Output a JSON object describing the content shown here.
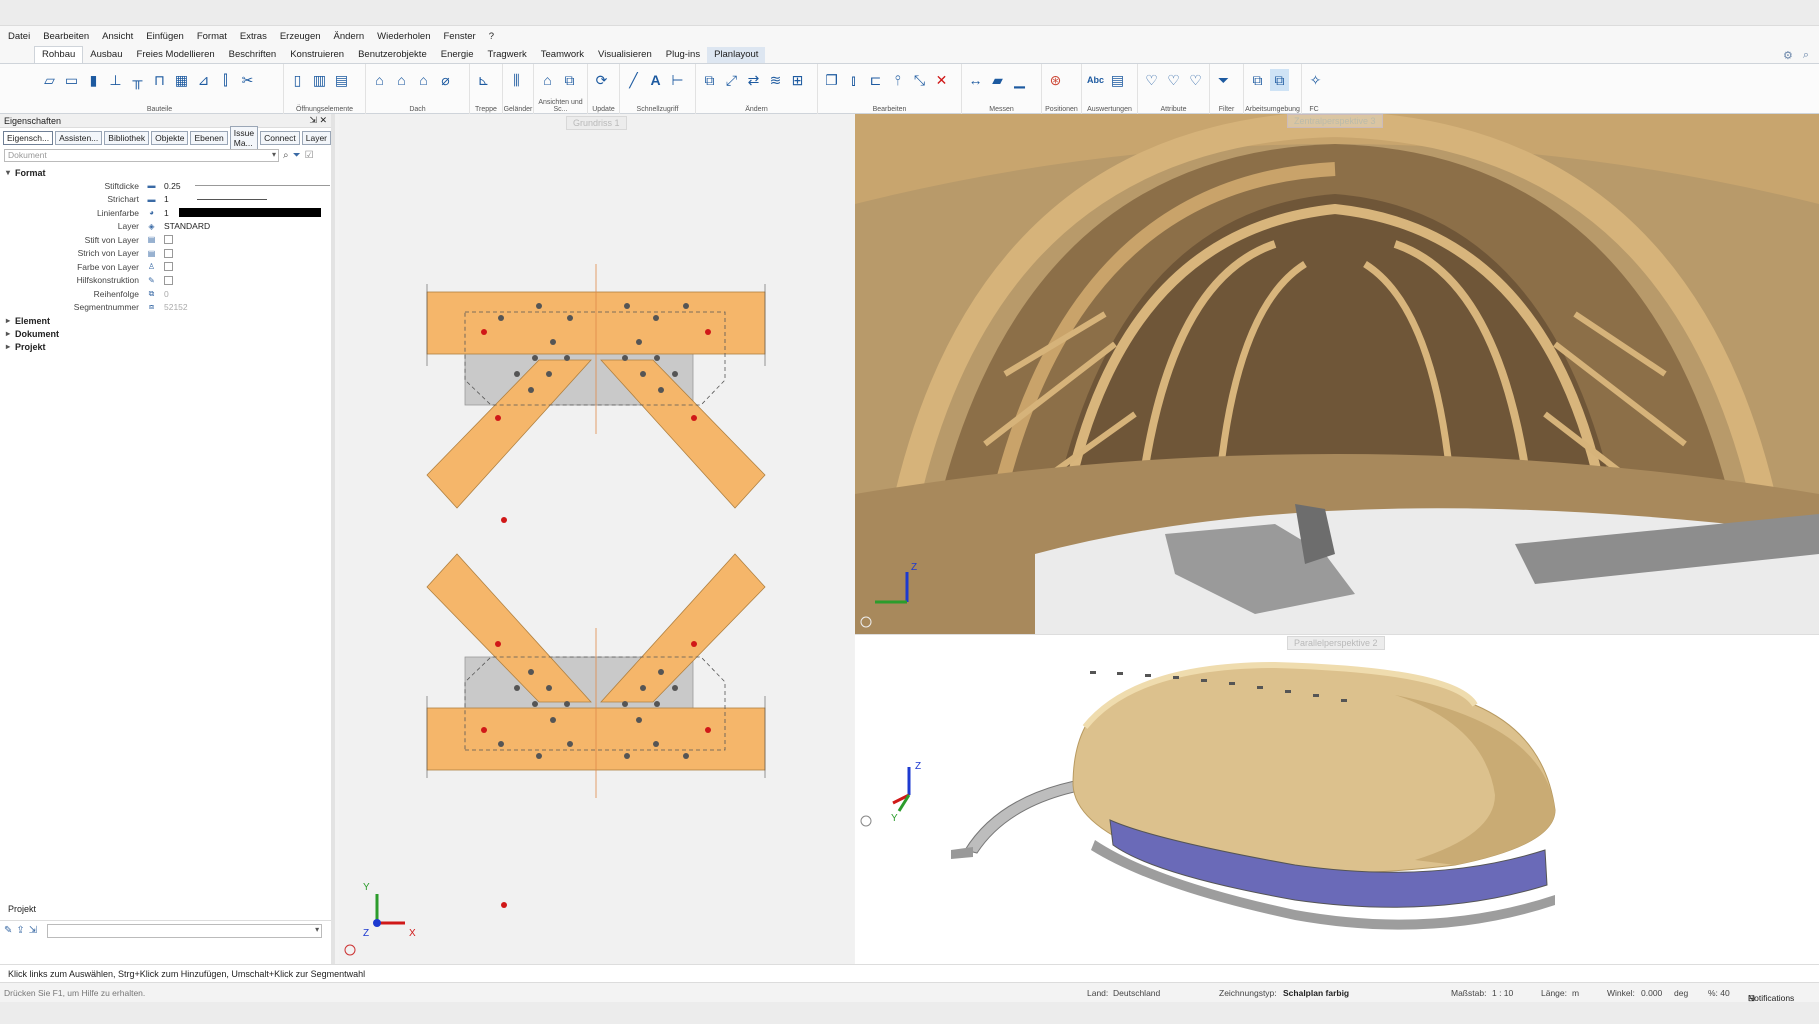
{
  "menu": [
    "Datei",
    "Bearbeiten",
    "Ansicht",
    "Einfügen",
    "Format",
    "Extras",
    "Erzeugen",
    "Ändern",
    "Wiederholen",
    "Fenster",
    "?"
  ],
  "tabs": [
    "Rohbau",
    "Ausbau",
    "Freies Modellieren",
    "Beschriften",
    "Konstruieren",
    "Benutzerobjekte",
    "Energie",
    "Tragwerk",
    "Teamwork",
    "Visualisieren",
    "Plug-ins",
    "Planlayout"
  ],
  "ribbon_groups": [
    "Bauteile",
    "Öffnungselemente",
    "Dach",
    "Treppe",
    "Geländer",
    "Ansichten und Sc...",
    "Update",
    "Schnellzugriff",
    "Ändern",
    "Bearbeiten",
    "Messen",
    "Positionen",
    "Auswertungen",
    "Attribute",
    "Filter",
    "Arbeitsumgebung",
    "FC"
  ],
  "panel": {
    "title": "Eigenschaften",
    "controls": "⇲ ✕",
    "tabs": [
      "Eigensch...",
      "Assisten...",
      "Bibliothek",
      "Objekte",
      "Ebenen",
      "Issue Ma...",
      "Connect",
      "Layer"
    ],
    "search_placeholder": "Dokument",
    "format_section": "Format",
    "props": [
      {
        "label": "Stiftdicke",
        "value": "0.25"
      },
      {
        "label": "Strichart",
        "value": "1"
      },
      {
        "label": "Linienfarbe",
        "value": "1"
      },
      {
        "label": "Layer",
        "value": "STANDARD"
      },
      {
        "label": "Stift von Layer",
        "value": ""
      },
      {
        "label": "Strich von Layer",
        "value": ""
      },
      {
        "label": "Farbe von Layer",
        "value": ""
      },
      {
        "label": "Hilfskonstruktion",
        "value": ""
      },
      {
        "label": "Reihenfolge",
        "value": "0"
      },
      {
        "label": "Segmentnummer",
        "value": "52152"
      }
    ],
    "sections": [
      "Element",
      "Dokument",
      "Projekt"
    ],
    "bottom_label": "Projekt"
  },
  "viewports": {
    "plan_title": "Grundriss 1",
    "view_top_title": "Zentralperspektive 3",
    "view_bottom_title": "Parallelperspektive 2"
  },
  "message": "Klick links zum Auswählen, Strg+Klick zum Hinzufügen, Umschalt+Klick zur Segmentwahl",
  "status": {
    "hint": "Drücken Sie F1, um Hilfe zu erhalten.",
    "land_label": "Land:",
    "land_value": "Deutschland",
    "type_label": "Zeichnungstyp:",
    "type_value": "Schalplan farbig",
    "scale_label": "Maßstab:",
    "scale_value": "1 : 10",
    "length_label": "Länge:",
    "length_value": "m",
    "angle_label": "Winkel:",
    "angle_value": "0.000",
    "angle_unit": "deg",
    "percent": "%: 40",
    "notifications": "Notifications"
  },
  "colors": {
    "wood": "#f5b66a",
    "steel": "#c8c8c8",
    "accent": "#1d5aa0",
    "bolt_red": "#d01818"
  }
}
